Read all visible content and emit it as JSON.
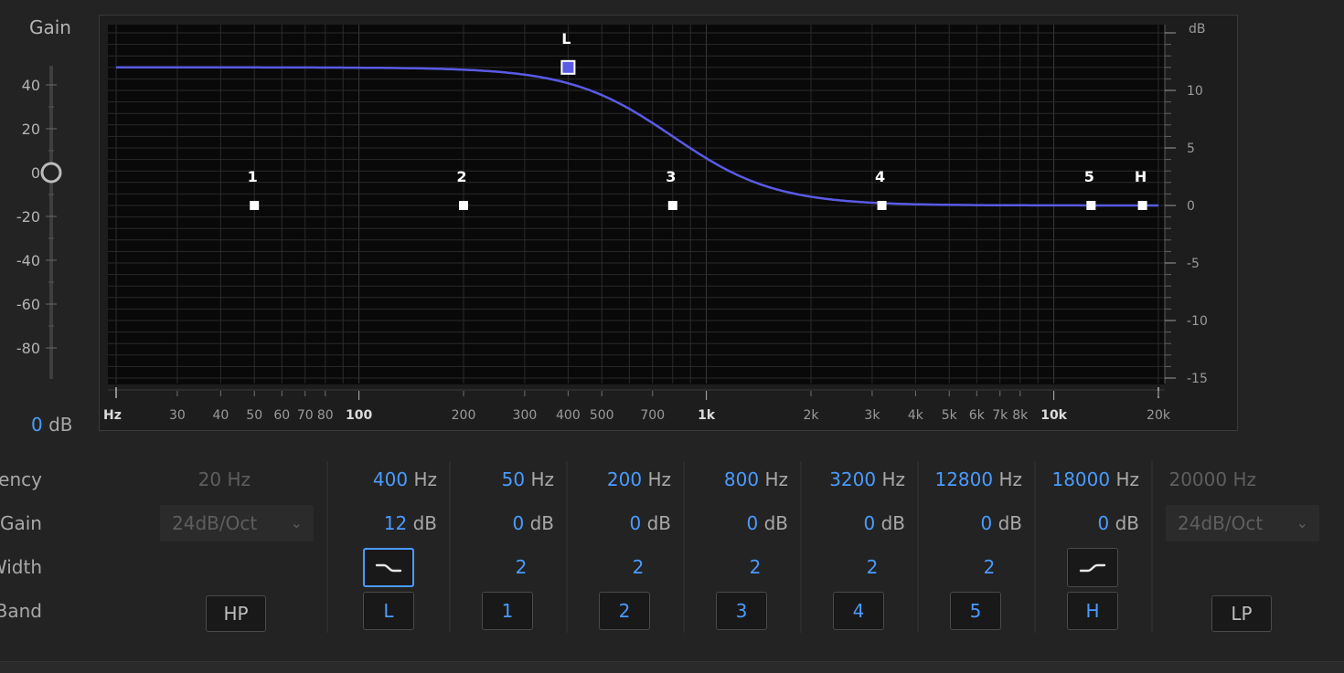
{
  "gain_panel": {
    "title": "Gain",
    "scale_labels": [
      "40",
      "20",
      "0",
      "-20",
      "-40",
      "-60",
      "-80"
    ],
    "readout_value": "0",
    "readout_unit": "dB",
    "knob_value_db": 0
  },
  "graph": {
    "freq_axis_unit": "Hz",
    "freq_tick_labels": [
      {
        "f": 30,
        "label": "30"
      },
      {
        "f": 40,
        "label": "40"
      },
      {
        "f": 50,
        "label": "50"
      },
      {
        "f": 60,
        "label": "60"
      },
      {
        "f": 70,
        "label": "70"
      },
      {
        "f": 80,
        "label": "80"
      },
      {
        "f": 100,
        "label": "100",
        "bold": true
      },
      {
        "f": 200,
        "label": "200"
      },
      {
        "f": 300,
        "label": "300"
      },
      {
        "f": 400,
        "label": "400"
      },
      {
        "f": 500,
        "label": "500"
      },
      {
        "f": 700,
        "label": "700"
      },
      {
        "f": 1000,
        "label": "1k",
        "bold": true
      },
      {
        "f": 2000,
        "label": "2k"
      },
      {
        "f": 3000,
        "label": "3k"
      },
      {
        "f": 4000,
        "label": "4k"
      },
      {
        "f": 5000,
        "label": "5k"
      },
      {
        "f": 6000,
        "label": "6k"
      },
      {
        "f": 7000,
        "label": "7k"
      },
      {
        "f": 8000,
        "label": "8k"
      },
      {
        "f": 10000,
        "label": "10k",
        "bold": true
      },
      {
        "f": 20000,
        "label": "20k"
      }
    ],
    "db_axis_unit": "dB",
    "db_tick_labels": [
      "10",
      "5",
      "0",
      "-5",
      "-10",
      "-15"
    ],
    "db_range": [
      -15,
      15
    ],
    "freq_range": [
      20,
      20000
    ],
    "curve_color": "#5a5ae6",
    "nodes": [
      {
        "id": "L",
        "label": "L",
        "freq": 400,
        "gain": 12,
        "selected": true
      },
      {
        "id": "1",
        "label": "1",
        "freq": 50,
        "gain": 0
      },
      {
        "id": "2",
        "label": "2",
        "freq": 200,
        "gain": 0
      },
      {
        "id": "3",
        "label": "3",
        "freq": 800,
        "gain": 0
      },
      {
        "id": "4",
        "label": "4",
        "freq": 3200,
        "gain": 0
      },
      {
        "id": "5",
        "label": "5",
        "freq": 12800,
        "gain": 0
      },
      {
        "id": "H",
        "label": "H",
        "freq": 18000,
        "gain": 0
      }
    ]
  },
  "rows": {
    "frequency_label": "Frequency",
    "gain_label": "Gain",
    "width_label": "Width",
    "band_label": "Band"
  },
  "hp": {
    "freq_value": "20",
    "freq_unit": "Hz",
    "slope": "24dB/Oct",
    "button": "HP"
  },
  "lp": {
    "freq_value": "20000",
    "freq_unit": "Hz",
    "slope": "24dB/Oct",
    "button": "LP"
  },
  "bands": [
    {
      "key": "L",
      "freq": "400",
      "gain": "12",
      "width": "",
      "button": "L",
      "shape": "low-shelf-icon"
    },
    {
      "key": "1",
      "freq": "50",
      "gain": "0",
      "width": "2",
      "button": "1"
    },
    {
      "key": "2",
      "freq": "200",
      "gain": "0",
      "width": "2",
      "button": "2"
    },
    {
      "key": "3",
      "freq": "800",
      "gain": "0",
      "width": "2",
      "button": "3"
    },
    {
      "key": "4",
      "freq": "3200",
      "gain": "0",
      "width": "2",
      "button": "4"
    },
    {
      "key": "5",
      "freq": "12800",
      "gain": "0",
      "width": "2",
      "button": "5"
    },
    {
      "key": "H",
      "freq": "18000",
      "gain": "0",
      "width": "",
      "button": "H",
      "shape": "high-shelf-icon"
    }
  ],
  "units": {
    "hz": "Hz",
    "db": "dB"
  }
}
